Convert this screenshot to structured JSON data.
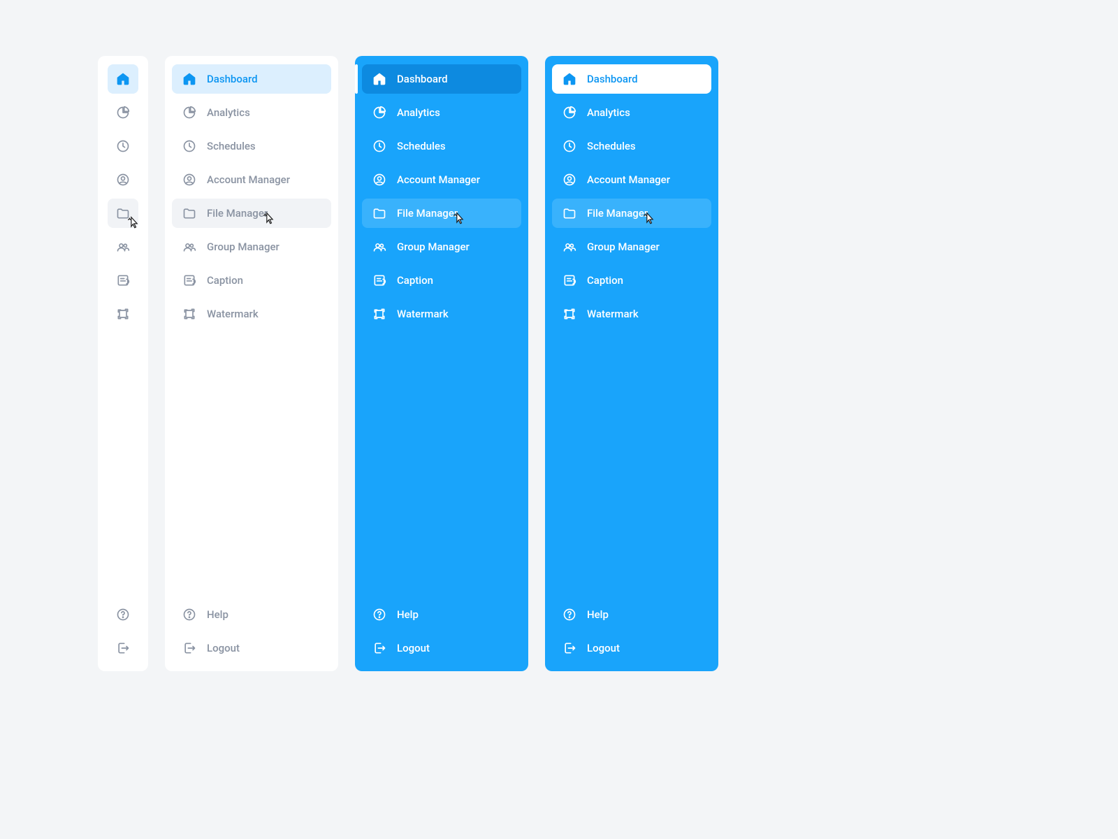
{
  "nav": [
    {
      "key": "dashboard",
      "label": "Dashboard",
      "icon": "home"
    },
    {
      "key": "analytics",
      "label": "Analytics",
      "icon": "piechart"
    },
    {
      "key": "schedules",
      "label": "Schedules",
      "icon": "clock"
    },
    {
      "key": "account-manager",
      "label": "Account Manager",
      "icon": "user"
    },
    {
      "key": "file-manager",
      "label": "File Manager",
      "icon": "folder"
    },
    {
      "key": "group-manager",
      "label": "Group Manager",
      "icon": "group"
    },
    {
      "key": "caption",
      "label": "Caption",
      "icon": "caption"
    },
    {
      "key": "watermark",
      "label": "Watermark",
      "icon": "watermark"
    }
  ],
  "footer": [
    {
      "key": "help",
      "label": "Help",
      "icon": "help"
    },
    {
      "key": "logout",
      "label": "Logout",
      "icon": "logout"
    }
  ],
  "active_key": "dashboard",
  "hover_key": "file-manager",
  "colors": {
    "brand_blue": "#19a4fb",
    "active_tint_light": "#dceffe",
    "active_blue_dark": "#0d8ae0",
    "text_muted": "#8a93a2",
    "bg": "#f3f5f7"
  }
}
